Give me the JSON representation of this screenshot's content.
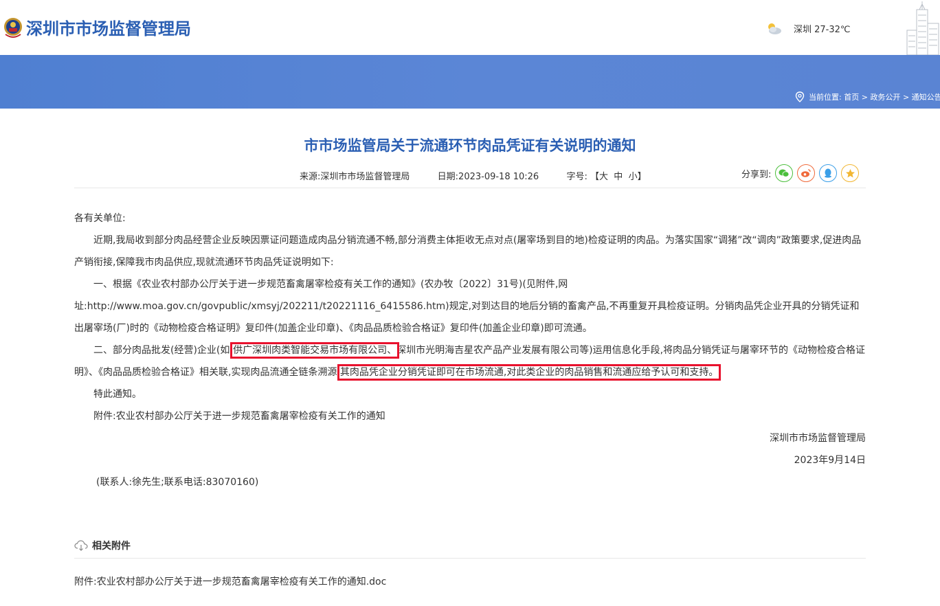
{
  "header": {
    "site_title": "深圳市市场监督管理局",
    "weather": "深圳 27-32℃",
    "breadcrumb_label": "当前位置:",
    "breadcrumb_items": [
      "首页",
      "政务公开",
      "通知公告"
    ],
    "breadcrumb_sep": ">"
  },
  "article": {
    "title": "市市场监管局关于流通环节肉品凭证有关说明的通知",
    "source": "来源:深圳市市场监督管理局",
    "date": "日期:2023-09-18 10:26",
    "font_size_label": "字号:",
    "font_size_options": [
      "【大",
      "中",
      "小】"
    ],
    "share_label": "分享到:",
    "greeting": "各有关单位:",
    "para1": "近期,我局收到部分肉品经营企业反映因票证问题造成肉品分销流通不畅,部分消费主体拒收无点对点(屠宰场到目的地)检疫证明的肉品。为落实国家“调猪”改“调肉”政策要求,促进肉品产销衔接,保障我市肉品供应,现就流通环节肉品凭证说明如下:",
    "para2": "一、根据《农业农村部办公厅关于进一步规范畜禽屠宰检疫有关工作的通知》(农办牧〔2022〕31号)(见附件,网址:http://www.moa.gov.cn/govpublic/xmsyj/202211/t20221116_6415586.htm)规定,对到达目的地后分销的畜禽产品,不再重复开具检疫证明。分销肉品凭企业开具的分销凭证和出屠宰场(厂)时的《动物检疫合格证明》复印件(加盖企业印章)、《肉品品质检验合格证》复印件(加盖企业印章)即可流通。",
    "para3_a": "二、部分肉品批发(经营)企业(如:",
    "para3_hl1": "供广深圳肉类智能交易市场有限公司、",
    "para3_b": "深圳市光明海吉星农产品产业发展有限公司等)运用信息化手段,将肉品分销凭证与屠宰环节的《动物检疫合格证明》、《肉品品质检验合格证》相关联,实现肉品流通全链条溯源,",
    "para3_hl2": "其肉品凭企业分销凭证即可在市场流通,对此类企业的肉品销售和流通应给予认可和支持。",
    "closing": "特此通知。",
    "attachment_note": "附件:农业农村部办公厅关于进一步规范畜禽屠宰检疫有关工作的通知",
    "signature": "深圳市市场监督管理局",
    "sign_date": "2023年9月14日",
    "contact": "(联系人:徐先生;联系电话:83070160)"
  },
  "attachments": {
    "heading": "相关附件",
    "file": "附件:农业农村部办公厅关于进一步规范畜禽屠宰检疫有关工作的通知.doc"
  },
  "colors": {
    "brand_blue": "#2b5fb3",
    "banner_blue": "#5681d4",
    "highlight_red": "#e8112d",
    "wechat_green": "#4cbf3d",
    "weibo_orange": "#f06a3b",
    "qq_blue": "#3b9fe8",
    "favorite_yellow": "#f2b632"
  },
  "icons": [
    "emblem-logo",
    "partly-cloudy-icon",
    "location-pin-icon",
    "wechat-icon",
    "weibo-icon",
    "qq-icon",
    "favorite-icon",
    "download-cloud-icon"
  ]
}
